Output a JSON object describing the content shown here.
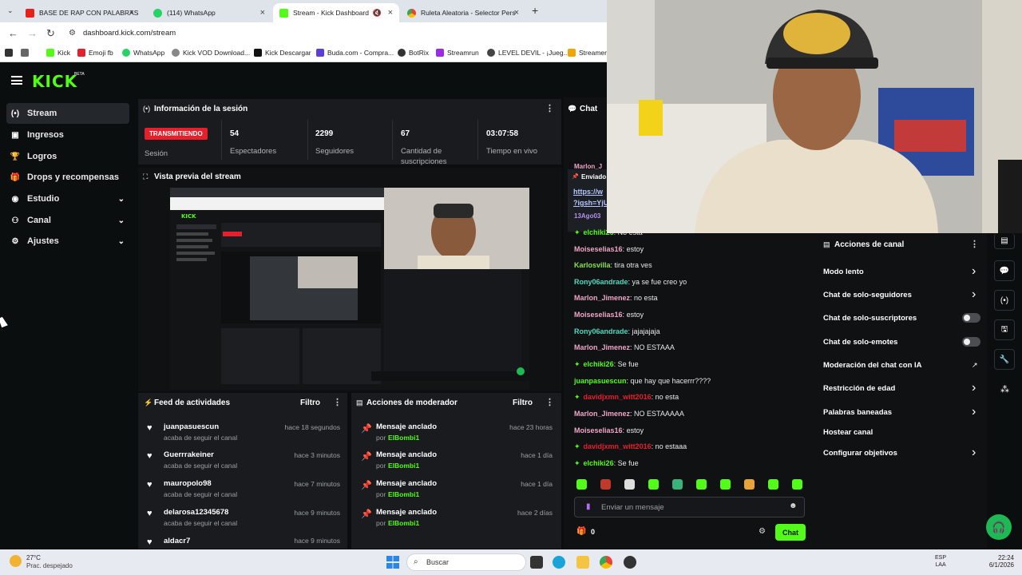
{
  "browser": {
    "tabs": [
      {
        "label": "BASE DE RAP CON PALABRAS",
        "icon": "youtube-icon"
      },
      {
        "label": "(114) WhatsApp",
        "icon": "whatsapp-icon"
      },
      {
        "label": "Stream - Kick Dashboard",
        "icon": "kick-icon",
        "active": true
      },
      {
        "label": "Ruleta Aleatoria - Selector Pers",
        "icon": "chrome-icon"
      }
    ],
    "url": "dashboard.kick.com/stream",
    "bookmarks": [
      "Kick",
      "Emoji fb",
      "WhatsApp",
      "Kick VOD Download...",
      "Kick Descargar",
      "Buda.com - Compra...",
      "BotRix",
      "Streamrun",
      "LEVEL DEVIL - ¡Jueg...",
      "StreamerS"
    ]
  },
  "header": {
    "logo": "KICK",
    "beta": "BETA"
  },
  "sidebar": [
    {
      "label": "Stream",
      "icon": "broadcast-icon",
      "active": true
    },
    {
      "label": "Ingresos",
      "icon": "wallet-icon"
    },
    {
      "label": "Logros",
      "icon": "trophy-icon"
    },
    {
      "label": "Drops y recompensas",
      "icon": "gift-icon"
    },
    {
      "label": "Estudio",
      "icon": "studio-icon",
      "expandable": true
    },
    {
      "label": "Canal",
      "icon": "channel-icon",
      "expandable": true
    },
    {
      "label": "Ajustes",
      "icon": "gear-icon",
      "expandable": true
    }
  ],
  "session": {
    "title": "Información de la sesión",
    "badge": "TRANSMITIENDO",
    "badge_label": "Sesión",
    "stats": [
      {
        "value": "54",
        "label": "Espectadores"
      },
      {
        "value": "2299",
        "label": "Seguidores"
      },
      {
        "value": "67",
        "label": "Cantidad de suscripciones"
      },
      {
        "value": "03:07:58",
        "label": "Tiempo en vivo"
      }
    ]
  },
  "preview": {
    "title": "Vista previa del stream"
  },
  "feed": {
    "title": "Feed de actividades",
    "filter": "Filtro",
    "items": [
      {
        "name": "juanpasuescun",
        "action": "acaba de seguir el canal",
        "time": "hace 18 segundos"
      },
      {
        "name": "Guerrrakeiner",
        "action": "acaba de seguir el canal",
        "time": "hace 3 minutos"
      },
      {
        "name": "mauropolo98",
        "action": "acaba de seguir el canal",
        "time": "hace 7 minutos"
      },
      {
        "name": "delarosa12345678",
        "action": "acaba de seguir el canal",
        "time": "hace 9 minutos"
      },
      {
        "name": "aldacr7",
        "action": "",
        "time": "hace 9 minutos"
      }
    ]
  },
  "moderator": {
    "title": "Acciones de moderador",
    "filter": "Filtro",
    "items": [
      {
        "title": "Mensaje anclado",
        "by": "por",
        "user": "ElBombi1",
        "time": "hace 23 horas"
      },
      {
        "title": "Mensaje anclado",
        "by": "por",
        "user": "ElBombi1",
        "time": "hace 1 día"
      },
      {
        "title": "Mensaje anclado",
        "by": "por",
        "user": "ElBombi1",
        "time": "hace 1 día"
      },
      {
        "title": "Mensaje anclado",
        "by": "por",
        "user": "ElBombi1",
        "time": "hace 2 días"
      }
    ]
  },
  "chat": {
    "title": "Chat",
    "pinned": {
      "label": "Enviado",
      "link1": "https://w",
      "link2": "?igsh=YjU",
      "partial_user": "Marlon_J",
      "partial_user2": "13Ago03"
    },
    "messages": [
      {
        "user": "elchiki26",
        "text": "No esta",
        "color": "#53fc18",
        "badge": true
      },
      {
        "user": "Moiseselias16",
        "text": "estoy",
        "color": "#f0a6c7"
      },
      {
        "user": "Karlosvilla",
        "text": "tira otra ves",
        "color": "#8be04e"
      },
      {
        "user": "Rony06andrade",
        "text": "ya se fue creo yo",
        "color": "#4ed9c1"
      },
      {
        "user": "Marlon_Jimenez",
        "text": "no esta",
        "color": "#f0a6c7"
      },
      {
        "user": "Moiseselias16",
        "text": "estoy",
        "color": "#f0a6c7"
      },
      {
        "user": "Rony06andrade",
        "text": "jajajajaja",
        "color": "#4ed9c1"
      },
      {
        "user": "Marlon_Jimenez",
        "text": "NO ESTAAA",
        "color": "#f0a6c7"
      },
      {
        "user": "elchiki26",
        "text": "Se fue",
        "color": "#53fc18",
        "badge": true
      },
      {
        "user": "juanpasuescun",
        "text": "que hay que hacerrr????",
        "color": "#53fc18"
      },
      {
        "user": "davidjxmn_witt2016",
        "text": "no esta",
        "color": "#e5202d",
        "badge": true
      },
      {
        "user": "Marlon_Jimenez",
        "text": "NO ESTAAAAA",
        "color": "#f0a6c7"
      },
      {
        "user": "Moiseselias16",
        "text": "estoy",
        "color": "#f0a6c7"
      },
      {
        "user": "davidjxmn_witt2016",
        "text": "no estaaa",
        "color": "#e5202d",
        "badge": true
      },
      {
        "user": "elchiki26",
        "text": "Se fue",
        "color": "#53fc18",
        "badge": true
      }
    ],
    "input_placeholder": "Enviar un mensaje",
    "points": "0",
    "send_label": "Chat"
  },
  "actions": {
    "title": "Acciones de canal",
    "items": [
      {
        "label": "Modo lento",
        "kind": "chevron"
      },
      {
        "label": "Chat de solo-seguidores",
        "kind": "chevron"
      },
      {
        "label": "Chat de solo-suscriptores",
        "kind": "toggle"
      },
      {
        "label": "Chat de solo-emotes",
        "kind": "toggle"
      },
      {
        "label": "Moderación del chat con IA",
        "kind": "external"
      },
      {
        "label": "Restricción de edad",
        "kind": "chevron"
      },
      {
        "label": "Palabras baneadas",
        "kind": "chevron"
      },
      {
        "label": "Hostear canal",
        "kind": "none"
      },
      {
        "label": "Configurar objetivos",
        "kind": "chevron"
      }
    ]
  },
  "taskbar": {
    "temp": "27°C",
    "weather": "Prac. despejado",
    "search": "Buscar",
    "lang1": "ESP",
    "lang2": "LAA",
    "time": "22:24",
    "date": "6/1/2026"
  },
  "colors": {
    "accent": "#53fc18",
    "live": "#e5202d",
    "panel": "#191b1f"
  }
}
